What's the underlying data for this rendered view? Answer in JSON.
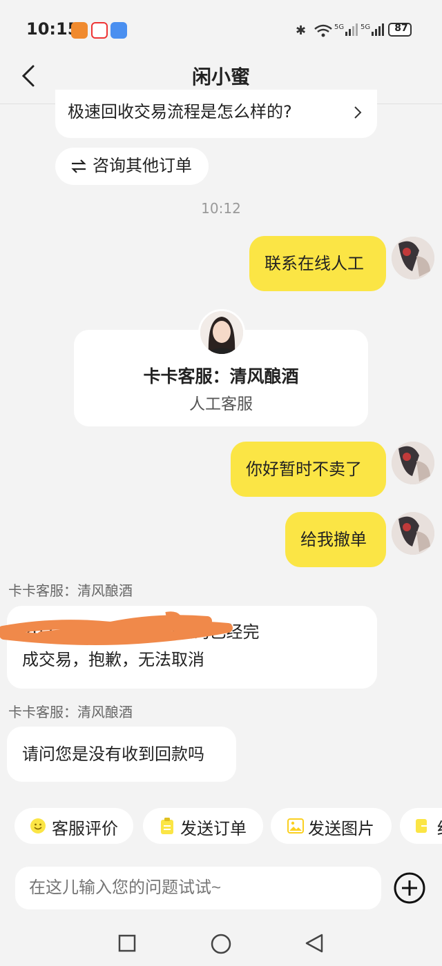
{
  "status": {
    "time": "10:15",
    "battery": "87"
  },
  "header": {
    "title": "闲小蜜"
  },
  "top_card": {
    "question": "极速回收交易流程是怎么样的?"
  },
  "consult_button": {
    "label": "咨询其他订单"
  },
  "timestamp": "10:12",
  "messages": {
    "m1": "联系在线人工",
    "agent_card": {
      "name": "卡卡客服：清风酿酒",
      "role": "人工客服"
    },
    "m2": "你好暂时不卖了",
    "m3": "给我撤单",
    "sender1": "卡卡客服：清风酿酒",
    "r1_line1": "202380       80订单查询已经完",
    "r1_line2": "成交易，抱歉，无法取消",
    "sender2": "卡卡客服：清风酿酒",
    "r2": "请问您是没有收到回款吗"
  },
  "quick_actions": [
    "客服评价",
    "发送订单",
    "发送图片",
    "结"
  ],
  "input": {
    "placeholder": "在这儿输入您的问题试试~"
  },
  "colors": {
    "accent": "#fbe545",
    "background": "#f3f3f3",
    "redaction": "#f0894a"
  }
}
